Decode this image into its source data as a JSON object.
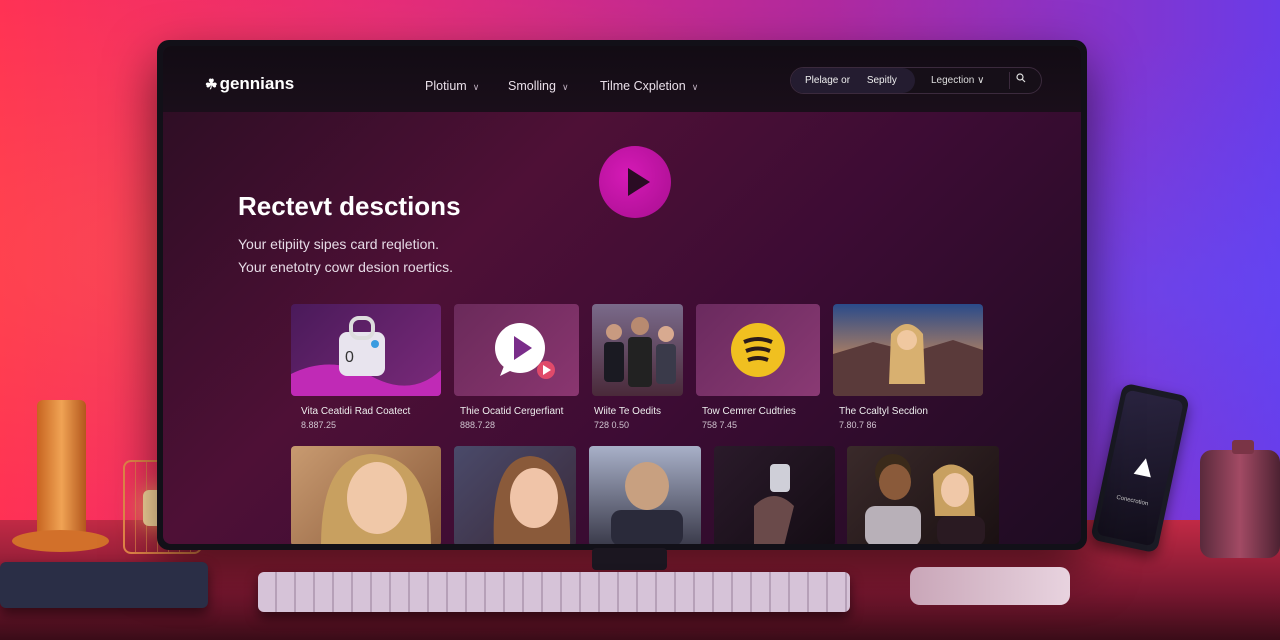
{
  "app": {
    "logo": "gennians"
  },
  "nav": {
    "menu": [
      {
        "label": "Plotium"
      },
      {
        "label": "Smolling"
      },
      {
        "label": "Tilme Cxpletion"
      }
    ],
    "search_label": "Plelage or",
    "search_value": "Sepitly",
    "legend_select": "Legection ∨"
  },
  "hero": {
    "title": "Rectevt desctions",
    "subtitle_lines": [
      "Your etipiity sipes card reqletion.",
      "Your enetotry cowr desion roertics."
    ]
  },
  "cards_row1": [
    {
      "title": "Vita Ceatidi Rad Coatect",
      "sub": "8.887.25"
    },
    {
      "title": "Thie Ocatid Cergerfiant",
      "sub": "888.7.28"
    },
    {
      "title": "Wiite Te Oedits",
      "sub": "728 0.50"
    },
    {
      "title": "Tow Cemrer Cudtries",
      "sub": "758 7.45"
    },
    {
      "title": "The Ccaltyl Secdion",
      "sub": "7.80.7 86"
    }
  ],
  "device": {
    "phone_text": "Conecrotion"
  },
  "colors": {
    "accent": "#c2159f",
    "background_left": "#ff2f55",
    "background_right": "#6a3be8"
  }
}
